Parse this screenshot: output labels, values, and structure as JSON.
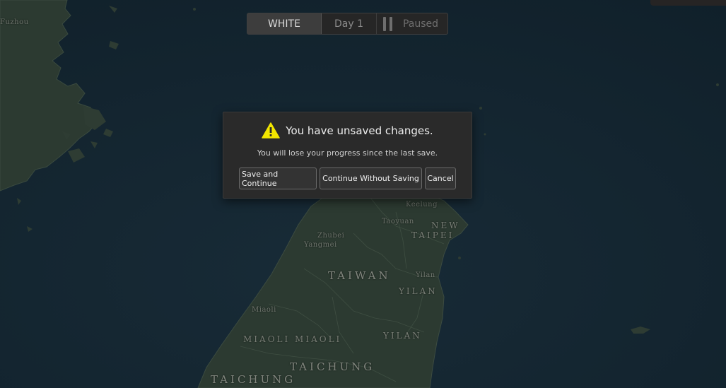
{
  "topbar": {
    "team_label": "WHITE",
    "day_label": "Day 1",
    "status_label": "Paused"
  },
  "dialog": {
    "title": "You have unsaved changes.",
    "message": "You will lose your progress since the last save.",
    "buttons": {
      "save_continue": "Save and Continue",
      "continue_without_saving": "Continue Without Saving",
      "cancel": "Cancel"
    },
    "icon": "warning-icon"
  },
  "map": {
    "labels": {
      "taiwan": "TAIWAN",
      "new_taipei_1": "NEW",
      "new_taipei_2": "TAIPEI",
      "yilan_city": "Yilan",
      "yilan_county": "YILAN",
      "yilan_2": "YILAN",
      "zhubei": "Zhubei",
      "yangmei": "Yangmei",
      "miaoli_city": "Miaoli",
      "miaoli_county": "MIAOLI  MIAOLI",
      "taichung": "TAICHUNG",
      "taichung_2": "TAICHUNG",
      "keelung": "Keelung",
      "taoyuan": "Taoyuan",
      "fuzhou": "Fuzhou"
    }
  },
  "colors": {
    "ocean": "#13242f",
    "land": "#2c3a31",
    "dialog_bg": "#2a2a2a",
    "warning": "#f2e600"
  }
}
